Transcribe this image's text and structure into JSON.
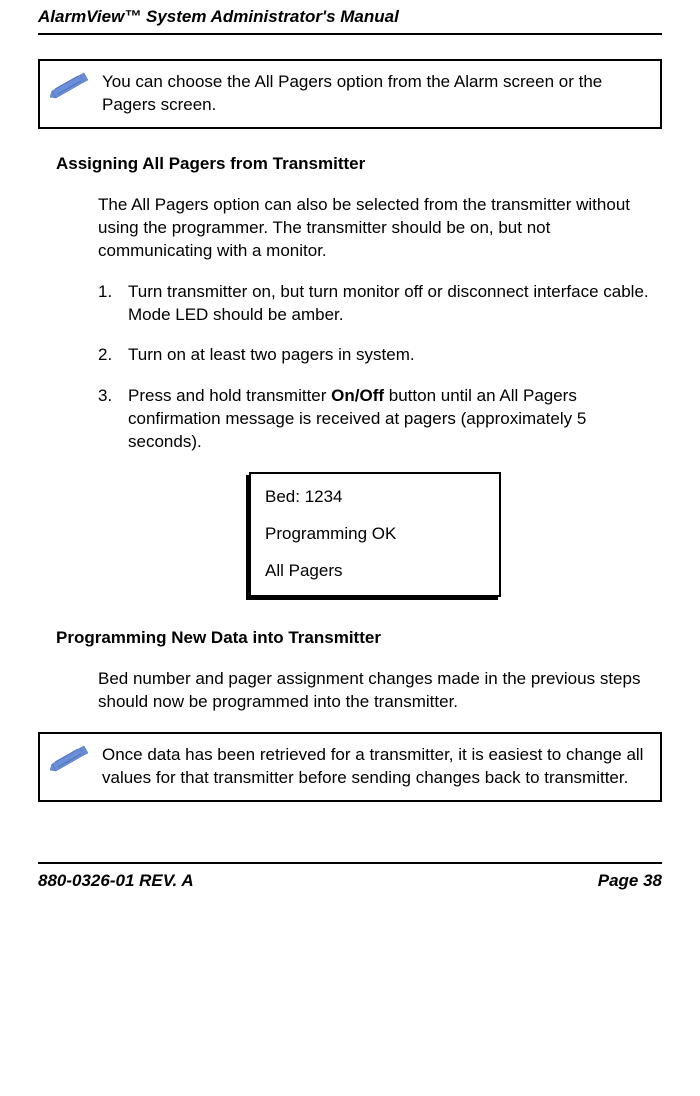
{
  "header": {
    "title": "AlarmView™ System Administrator's Manual"
  },
  "note1": {
    "text": "You can choose the All Pagers option from the Alarm screen or the Pagers screen."
  },
  "section1": {
    "heading": "Assigning All Pagers from Transmitter",
    "intro": "The All Pagers option can also be selected from the transmitter without using the programmer. The transmitter should be on, but not communicating with a monitor.",
    "steps": [
      {
        "num": "1.",
        "text": "Turn transmitter on, but turn monitor off or disconnect interface cable. Mode LED should be amber."
      },
      {
        "num": "2.",
        "text": "Turn on at least two pagers in system."
      },
      {
        "num": "3.",
        "before": "Press and hold transmitter ",
        "bold": "On/Off",
        "after": " button until an All Pagers confirmation message is received at pagers (approximately 5 seconds)."
      }
    ]
  },
  "display": {
    "line1": "Bed: 1234",
    "line2": "Programming OK",
    "line3": "All Pagers"
  },
  "section2": {
    "heading": "Programming New Data into Transmitter",
    "intro": "Bed number and pager assignment changes made in the previous steps should now be programmed into the transmitter."
  },
  "note2": {
    "text": "Once data has been retrieved for a transmitter, it is easiest to change all values for that transmitter before sending changes back to transmitter."
  },
  "footer": {
    "left": "880-0326-01 REV. A",
    "right": "Page 38"
  }
}
